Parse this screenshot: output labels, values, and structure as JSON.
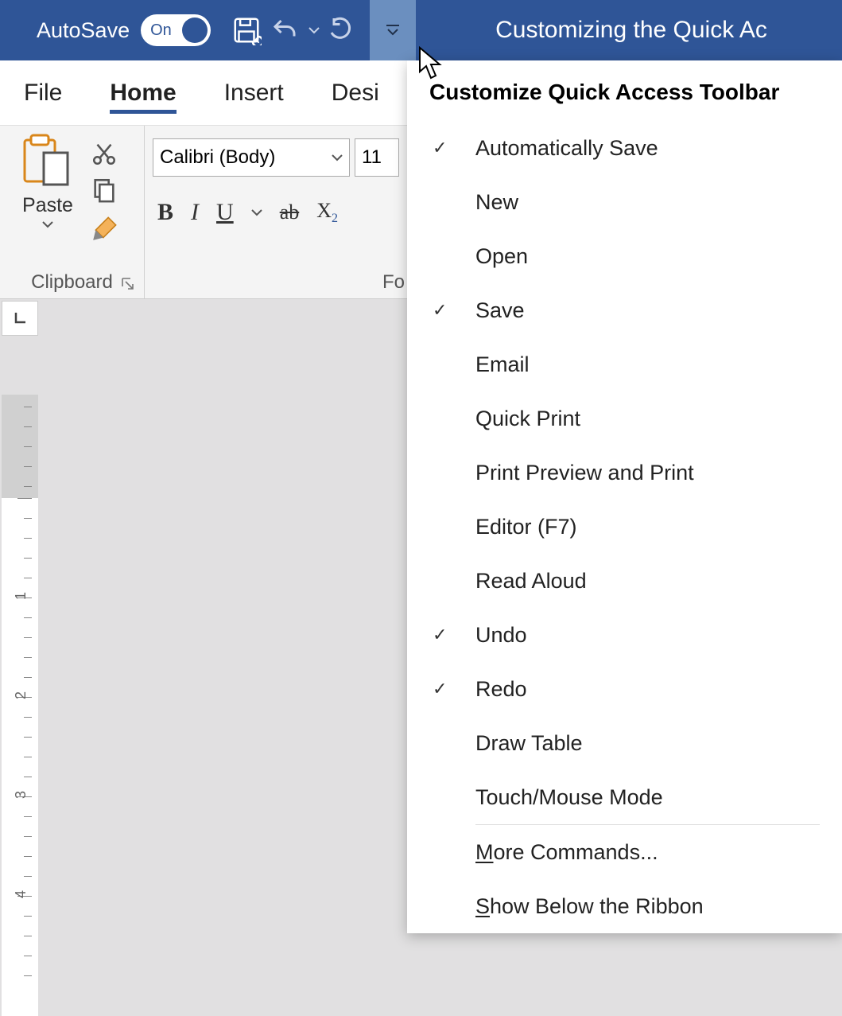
{
  "titlebar": {
    "autosave_label": "AutoSave",
    "toggle_text": "On",
    "doc_title": "Customizing the Quick Ac"
  },
  "tabs": {
    "file": "File",
    "home": "Home",
    "insert": "Insert",
    "design": "Desi"
  },
  "ribbon": {
    "clipboard": {
      "paste_label": "Paste",
      "group_name": "Clipboard"
    },
    "font": {
      "font_name": "Calibri (Body)",
      "font_size": "11",
      "bold": "B",
      "italic": "I",
      "underline": "U",
      "strike": "ab",
      "subscript_x": "X",
      "subscript_2": "2",
      "group_name": "Fo"
    }
  },
  "dropdown": {
    "title": "Customize Quick Access Toolbar",
    "items": [
      {
        "label": "Automatically Save",
        "checked": true
      },
      {
        "label": "New",
        "checked": false
      },
      {
        "label": "Open",
        "checked": false
      },
      {
        "label": "Save",
        "checked": true
      },
      {
        "label": "Email",
        "checked": false
      },
      {
        "label": "Quick Print",
        "checked": false
      },
      {
        "label": "Print Preview and Print",
        "checked": false
      },
      {
        "label": "Editor (F7)",
        "checked": false
      },
      {
        "label": "Read Aloud",
        "checked": false
      },
      {
        "label": "Undo",
        "checked": true
      },
      {
        "label": "Redo",
        "checked": true
      },
      {
        "label": "Draw Table",
        "checked": false
      },
      {
        "label": "Touch/Mouse Mode",
        "checked": false
      }
    ],
    "more_commands_pre": "M",
    "more_commands_post": "ore Commands...",
    "show_below_pre": "S",
    "show_below_post": "how Below the Ribbon"
  },
  "ruler": {
    "n1": "1",
    "n2": "2",
    "n3": "3",
    "n4": "4"
  }
}
